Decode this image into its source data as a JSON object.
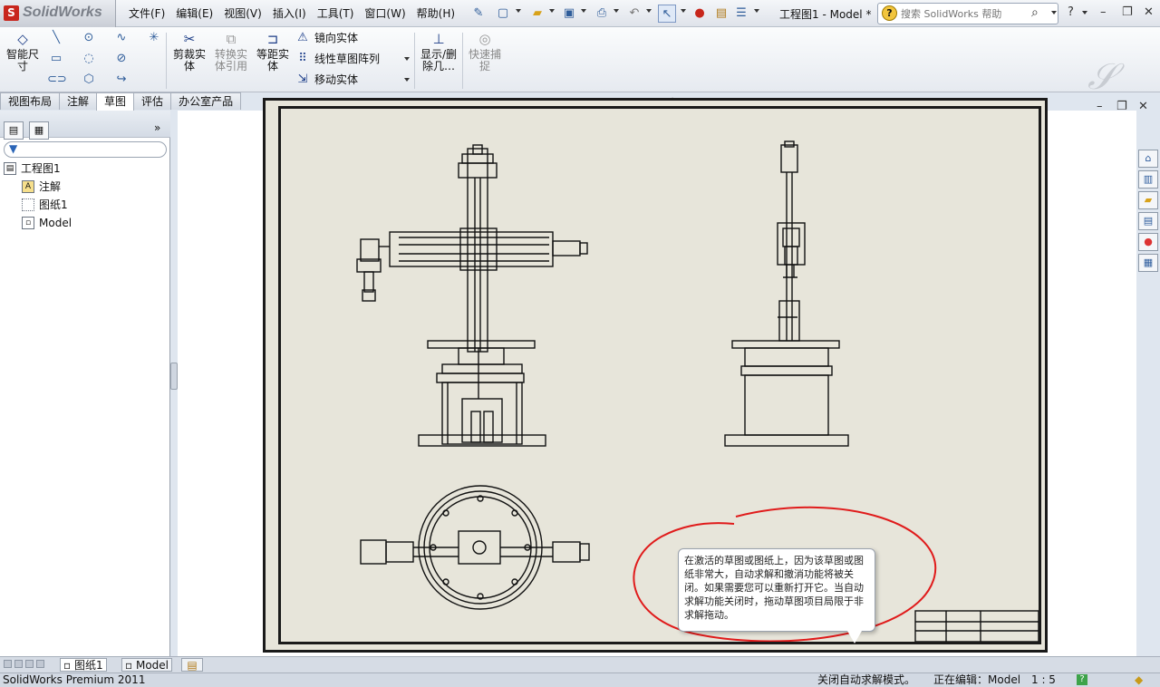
{
  "app": {
    "logo_text": "SolidWorks",
    "doc_title": "工程图1 - Model *"
  },
  "menu": [
    "文件(F)",
    "编辑(E)",
    "视图(V)",
    "插入(I)",
    "工具(T)",
    "窗口(W)",
    "帮助(H)"
  ],
  "help_search": {
    "placeholder": "搜索 SolidWorks 帮助"
  },
  "ribbon": {
    "smart_dim": "智能尺\n寸",
    "trim": "剪裁实\n体",
    "convert": "转换实\n体引用",
    "offset": "等距实\n体",
    "mirror": "镜向实体",
    "linear_pattern": "线性草图阵列",
    "move": "移动实体",
    "show_hide": "显示/删\n除几…",
    "quick_snap": "快速捕\n捉"
  },
  "tabs": [
    "视图布局",
    "注解",
    "草图",
    "评估",
    "办公室产品"
  ],
  "active_tab": "草图",
  "tree": {
    "root": "工程图1",
    "items": [
      "注解",
      "图纸1",
      "Model"
    ]
  },
  "tooltip": {
    "text": "在激活的草图或图纸上，因为该草图或图纸非常大，自动求解和撤消功能将被关闭。如果需要您可以重新打开它。当自动求解功能关闭时，拖动草图项目局限于非求解拖动。"
  },
  "sheet_tabs": [
    "图纸1",
    "Model"
  ],
  "status": {
    "product": "SolidWorks Premium 2011",
    "mode": "关闭自动求解模式。",
    "editing": "正在编辑：Model",
    "scale": "1 : 5"
  },
  "colors": {
    "annotation_ring": "#e01b1b",
    "sheet_bg": "#e7e5da",
    "tab_active": "#ffffff"
  }
}
